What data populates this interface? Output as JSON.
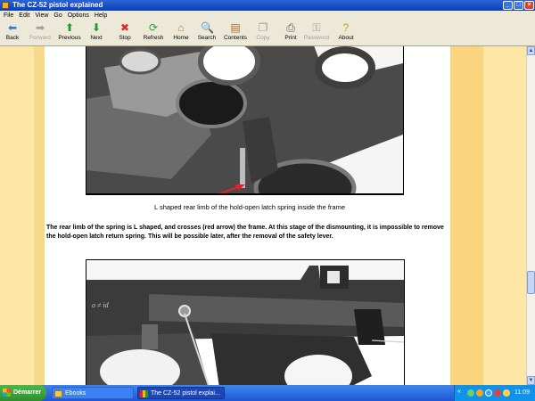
{
  "window": {
    "title": "The CZ-52 pistol explained"
  },
  "menu": [
    "File",
    "Edit",
    "View",
    "Go",
    "Options",
    "Help"
  ],
  "toolbar": [
    {
      "label": "Back",
      "icon": "arrow-left-icon",
      "glyph": "⬅",
      "color": "#2f7dd6",
      "enabled": true
    },
    {
      "label": "Forward",
      "icon": "arrow-right-icon",
      "glyph": "➡",
      "color": "#a09f96",
      "enabled": false
    },
    {
      "label": "Previous",
      "icon": "arrow-up-icon",
      "glyph": "⬆",
      "color": "#1f9a2b",
      "enabled": true
    },
    {
      "label": "Next",
      "icon": "arrow-down-icon",
      "glyph": "⬇",
      "color": "#1f9a2b",
      "enabled": true
    },
    {
      "label": "Stop",
      "icon": "stop-icon",
      "glyph": "✖",
      "color": "#d9302b",
      "enabled": true
    },
    {
      "label": "Refresh",
      "icon": "refresh-icon",
      "glyph": "⟳",
      "color": "#2f9a3d",
      "enabled": true
    },
    {
      "label": "Home",
      "icon": "home-icon",
      "glyph": "⌂",
      "color": "#b9822a",
      "enabled": true
    },
    {
      "label": "Search",
      "icon": "search-icon",
      "glyph": "🔍",
      "color": "#555555",
      "enabled": true
    },
    {
      "label": "Contents",
      "icon": "contents-icon",
      "glyph": "▤",
      "color": "#b06a2c",
      "enabled": true
    },
    {
      "label": "Copy",
      "icon": "copy-icon",
      "glyph": "❐",
      "color": "#a09f96",
      "enabled": false
    },
    {
      "label": "Print",
      "icon": "print-icon",
      "glyph": "⎙",
      "color": "#555555",
      "enabled": true
    },
    {
      "label": "Password",
      "icon": "key-icon",
      "glyph": "⚿",
      "color": "#a09f96",
      "enabled": false
    },
    {
      "label": "About",
      "icon": "help-icon",
      "glyph": "?",
      "color": "#c8a400",
      "enabled": true
    }
  ],
  "page": {
    "caption": "L shaped rear limb of the hold-open latch spring inside the frame",
    "paragraph": "The rear limb of the spring is L shaped, and crosses (red arrow) the frame. At this stage of the dismounting, it is impossible to remove the hold-open latch return spring. This will be possible later, after the removal of the safety lever.",
    "photo2_engraving": "o ≠ id"
  },
  "taskbar": {
    "start_label": "Démarrer",
    "tasks": [
      {
        "label": "Ebooks",
        "icon": "folder-icon"
      },
      {
        "label": "The CZ-52 pistol explai...",
        "icon": "ebook-icon"
      }
    ],
    "clock": "11:09"
  },
  "colors": {
    "band_light": "#fde6a6",
    "band_dark": "#fbd47f",
    "arrow_red": "#e0202a"
  }
}
